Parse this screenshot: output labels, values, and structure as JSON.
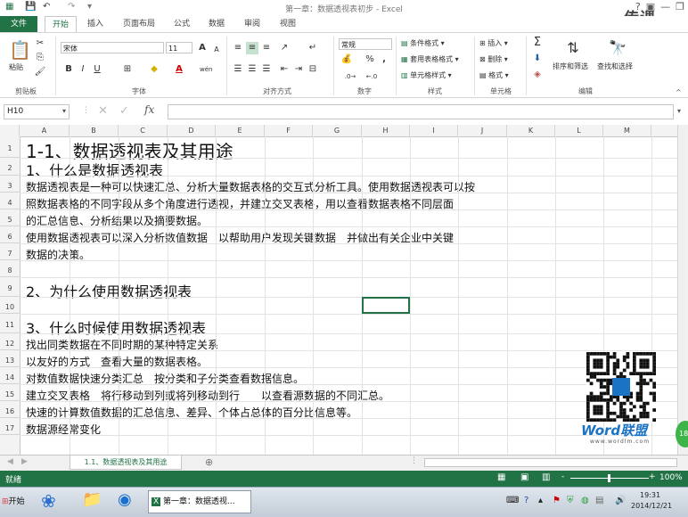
{
  "window": {
    "title": "第一章：数据透视表初步 - Excel",
    "help_label": "?",
    "login_label": "登录"
  },
  "ribbon_tabs": [
    "文件",
    "开始",
    "插入",
    "页面布局",
    "公式",
    "数据",
    "审阅",
    "视图"
  ],
  "ribbon": {
    "clipboard": {
      "paste_label": "粘贴",
      "group_label": "剪贴板"
    },
    "font": {
      "font_name": "宋体",
      "font_size": "11",
      "group_label": "字体",
      "bold": "B",
      "italic": "I",
      "underline": "U",
      "grow": "A",
      "shrink": "A",
      "font_color": "A",
      "wen": "wén"
    },
    "alignment": {
      "group_label": "对齐方式"
    },
    "number": {
      "format": "常规",
      "percent": "%",
      "comma": ",",
      "group_label": "数字"
    },
    "styles": {
      "conditional": "条件格式",
      "table": "套用表格格式",
      "cell_styles": "单元格样式",
      "group_label": "样式"
    },
    "cells": {
      "insert": "插入",
      "delete": "删除",
      "format": "格式",
      "group_label": "单元格"
    },
    "editing": {
      "sort_filter": "排序和筛选",
      "find_select": "查找和选择",
      "group_label": "编辑"
    }
  },
  "formula_bar": {
    "name_box": "H10",
    "fx": "fx",
    "content": ""
  },
  "columns": [
    "A",
    "B",
    "C",
    "D",
    "E",
    "F",
    "G",
    "H",
    "I",
    "J",
    "K",
    "L",
    "M"
  ],
  "rows": [
    {
      "num": "1",
      "text": "1-1、数据透视表及其用途"
    },
    {
      "num": "2",
      "text": "1、什么是数据透视表"
    },
    {
      "num": "3",
      "text": "数据透视表是一种可以快速汇总、分析大量数据表格的交互式分析工具。使用数据透视表可以按"
    },
    {
      "num": "4",
      "text": "照数据表格的不同字段从多个角度进行透视，并建立交叉表格，用以查看数据表格不同层面"
    },
    {
      "num": "5",
      "text": "的汇总信息、分析结果以及摘要数据。"
    },
    {
      "num": "6",
      "text": "使用数据透视表可以深入分析数值数据　以帮助用户发现关键数据　并做出有关企业中关键"
    },
    {
      "num": "7",
      "text": "数据的决策。"
    },
    {
      "num": "8",
      "text": ""
    },
    {
      "num": "9",
      "text": "2、为什么使用数据透视表"
    },
    {
      "num": "10",
      "text": ""
    },
    {
      "num": "11",
      "text": "3、什么时候使用数据透视表"
    },
    {
      "num": "12",
      "text": "找出同类数据在不同时期的某种特定关系"
    },
    {
      "num": "13",
      "text": "以友好的方式　查看大量的数据表格。"
    },
    {
      "num": "14",
      "text": "对数值数据快速分类汇总　按分类和子分类查看数据信息。"
    },
    {
      "num": "15",
      "text": "建立交叉表格　将行移动到列或将列移动到行　　以查看源数据的不同汇总。"
    },
    {
      "num": "16",
      "text": "快速的计算数值数据的汇总信息、差异、个体占总体的百分比信息等。"
    },
    {
      "num": "17",
      "text": "数据源经常变化"
    }
  ],
  "sheet_tab": "1.1、数据透视表及其用途",
  "status": {
    "ready": "就绪",
    "zoom": "100%",
    "minus": "-",
    "plus": "+"
  },
  "watermark": {
    "brand": "Word联盟",
    "url": "www.wordlm.com",
    "top": "传课"
  },
  "taskbar": {
    "start": "开始",
    "task_label": "第一章：数据透视...",
    "time": "19:31",
    "date": "2014/12/21"
  },
  "badge": "18"
}
